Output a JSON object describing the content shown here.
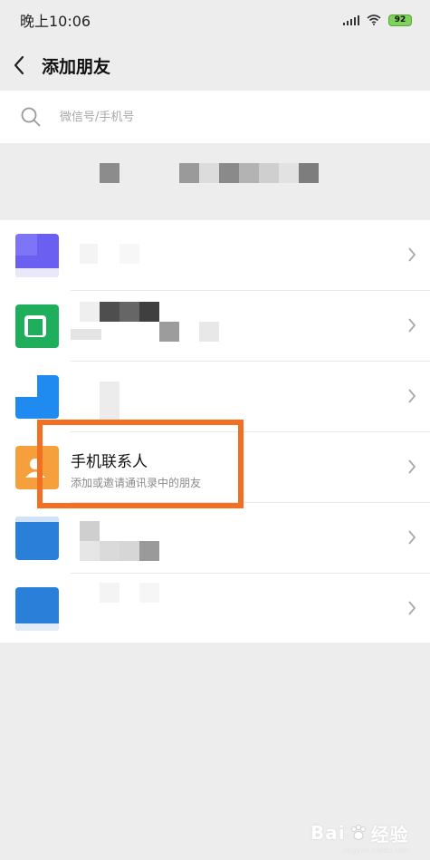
{
  "status": {
    "time": "晚上10:06",
    "battery": "92"
  },
  "nav": {
    "title": "添加朋友"
  },
  "search": {
    "placeholder": "微信号/手机号"
  },
  "list": {
    "phone_contacts": {
      "title": "手机联系人",
      "subtitle": "添加或邀请通讯录中的朋友"
    }
  },
  "colors": {
    "background": "#ededed",
    "highlight": "#f36f24",
    "phone_contacts_icon": "#f5a03c"
  },
  "watermark": {
    "text": "Bai",
    "suffix": "经验",
    "small": "jingyan.baidu.com"
  }
}
